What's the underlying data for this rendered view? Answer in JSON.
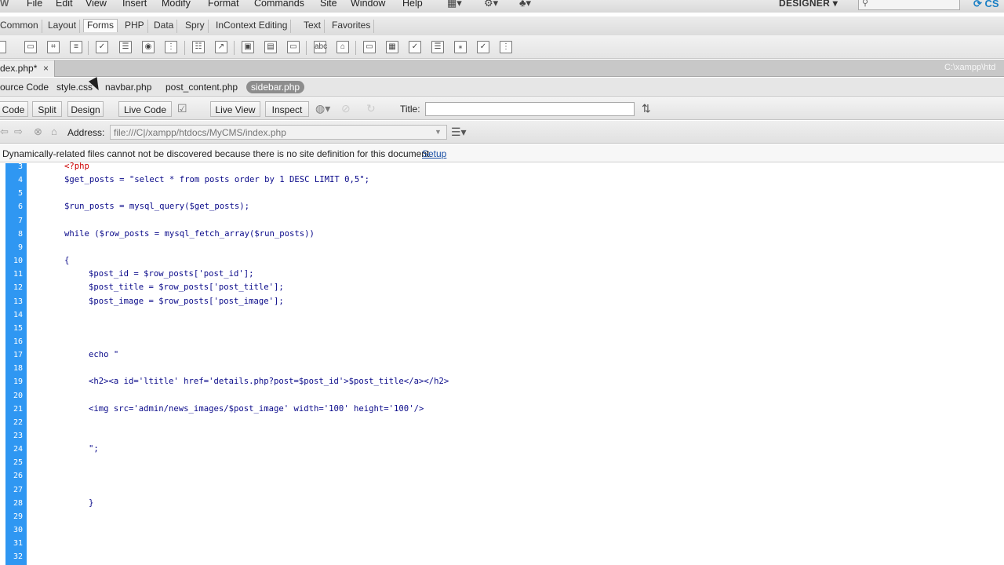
{
  "menubar": {
    "items": [
      "File",
      "Edit",
      "View",
      "Insert",
      "Modify",
      "Format",
      "Commands",
      "Site",
      "Window",
      "Help"
    ],
    "workspace": "DESIGNER",
    "cslive": "CS"
  },
  "insertbar": {
    "tabs": [
      "Common",
      "Layout",
      "Forms",
      "PHP",
      "Data",
      "Spry",
      "InContext Editing",
      "Text",
      "Favorites"
    ],
    "active_tab": "Forms"
  },
  "document": {
    "active_tab": "dex.php*",
    "close_symbol": "×",
    "path": "C:\\xampp\\htd"
  },
  "related_files": {
    "items": [
      "ource Code",
      "style.css",
      "navbar.php",
      "post_content.php",
      "sidebar.php"
    ],
    "active": "sidebar.php"
  },
  "viewbar": {
    "buttons": [
      "Code",
      "Split",
      "Design",
      "Live Code",
      "Live View",
      "Inspect"
    ],
    "title_label": "Title:",
    "title_value": ""
  },
  "address": {
    "label": "Address:",
    "value": "file:///C|/xampp/htdocs/MyCMS/index.php"
  },
  "info": {
    "message": "Dynamically-related files cannot not be discovered because there is no site definition for this document.",
    "link": "Setup"
  },
  "code": {
    "lines": [
      {
        "n": "3",
        "text": "<?php",
        "indent": 0
      },
      {
        "n": "4",
        "text": "$get_posts = \"select * from posts order by 1 DESC LIMIT 0,5\";",
        "indent": 0
      },
      {
        "n": "5",
        "text": "",
        "indent": 0
      },
      {
        "n": "6",
        "text": "$run_posts = mysql_query($get_posts);",
        "indent": 0
      },
      {
        "n": "7",
        "text": "",
        "indent": 0
      },
      {
        "n": "8",
        "text": "while ($row_posts = mysql_fetch_array($run_posts))",
        "indent": 0
      },
      {
        "n": "9",
        "text": "",
        "indent": 0
      },
      {
        "n": "10",
        "text": "{",
        "indent": 0
      },
      {
        "n": "11",
        "text": "$post_id = $row_posts['post_id'];",
        "indent": 1
      },
      {
        "n": "12",
        "text": "$post_title = $row_posts['post_title'];",
        "indent": 1
      },
      {
        "n": "13",
        "text": "$post_image = $row_posts['post_image'];",
        "indent": 1
      },
      {
        "n": "14",
        "text": "",
        "indent": 0
      },
      {
        "n": "15",
        "text": "",
        "indent": 0
      },
      {
        "n": "16",
        "text": "",
        "indent": 0
      },
      {
        "n": "17",
        "text": "echo \"",
        "indent": 1
      },
      {
        "n": "18",
        "text": "",
        "indent": 0
      },
      {
        "n": "19",
        "text": "<h2><a id='ltitle' href='details.php?post=$post_id'>$post_title</a></h2>",
        "indent": 1
      },
      {
        "n": "20",
        "text": "",
        "indent": 0
      },
      {
        "n": "21",
        "text": "<img src='admin/news_images/$post_image' width='100' height='100'/>",
        "indent": 1
      },
      {
        "n": "22",
        "text": "",
        "indent": 0
      },
      {
        "n": "23",
        "text": "",
        "indent": 0
      },
      {
        "n": "24",
        "text": "\";",
        "indent": 1
      },
      {
        "n": "25",
        "text": "",
        "indent": 0
      },
      {
        "n": "26",
        "text": "",
        "indent": 0
      },
      {
        "n": "27",
        "text": "",
        "indent": 0
      },
      {
        "n": "28",
        "text": "}",
        "indent": 1
      },
      {
        "n": "29",
        "text": "",
        "indent": 0
      },
      {
        "n": "30",
        "text": "",
        "indent": 0
      },
      {
        "n": "31",
        "text": "",
        "indent": 0
      },
      {
        "n": "32",
        "text": "",
        "indent": 0
      }
    ]
  },
  "colors": {
    "gutter": "#2f97f2",
    "code": "#0a0a8a",
    "php_tag": "#cc0000",
    "link": "#1a4fa5"
  }
}
